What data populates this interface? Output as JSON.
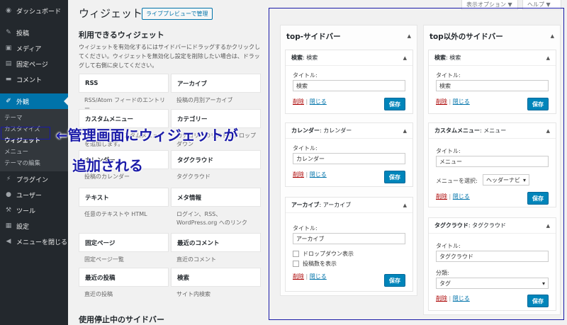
{
  "screen_meta": {
    "options": "表示オプション ▼",
    "help": "ヘルプ ▼"
  },
  "menu": {
    "dashboard": "ダッシュボード",
    "posts": "投稿",
    "media": "メディア",
    "pages": "固定ページ",
    "comments": "コメント",
    "appearance": "外観",
    "sub": {
      "themes": "テーマ",
      "customize": "カスタマイズ",
      "widgets": "ウィジェット",
      "menus": "メニュー",
      "editor": "テーマの編集"
    },
    "plugins": "プラグイン",
    "users": "ユーザー",
    "tools": "ツール",
    "settings": "設定",
    "collapse": "メニューを閉じる"
  },
  "page": {
    "title": "ウィジェット",
    "live_preview": "ライブプレビューで管理",
    "available_title": "利用できるウィジェット",
    "available_desc": "ウィジェットを有効化するにはサイドバーにドラッグするかクリックしてください。ウィジェットを無効化し設定を削除したい場合は、ドラッグして右側に戻してください。",
    "inactive_title": "使用停止中のサイドバー"
  },
  "widgets": [
    {
      "name": "RSS",
      "desc": "RSS/Atom フィードのエントリー"
    },
    {
      "name": "アーカイブ",
      "desc": "投稿の月別アーカイブ"
    },
    {
      "name": "カスタムメニュー",
      "desc": "サイドバーにカスタムメニューを追加します。"
    },
    {
      "name": "カテゴリー",
      "desc": "カテゴリーのリストやドロップダウン"
    },
    {
      "name": "カレンダー",
      "desc": "投稿のカレンダー"
    },
    {
      "name": "タグクラウド",
      "desc": "タグクラウド"
    },
    {
      "name": "テキスト",
      "desc": "任意のテキストや HTML"
    },
    {
      "name": "メタ情報",
      "desc": "ログイン、RSS、WordPress.org へのリンク"
    },
    {
      "name": "固定ページ",
      "desc": "固定ページ一覧"
    },
    {
      "name": "最近のコメント",
      "desc": "直近のコメント"
    },
    {
      "name": "最近の投稿",
      "desc": "直近の投稿"
    },
    {
      "name": "検索",
      "desc": "サイト内検索"
    }
  ],
  "annotation": {
    "line1": "←管理画面にウィジェットが",
    "line2": "追加される"
  },
  "common": {
    "title_label": "タイトル:",
    "delete": "削除",
    "close": "閉じる",
    "sep": "|",
    "save": "保存"
  },
  "sidebar_top": {
    "title": "top-サイドバー",
    "w1": {
      "head": "検索",
      "sub": ": 検索",
      "value": "検索"
    },
    "w2": {
      "head": "カレンダー",
      "sub": ": カレンダー",
      "value": "カレンダー"
    },
    "w3": {
      "head": "アーカイブ",
      "sub": ": アーカイブ",
      "value": "アーカイブ",
      "cb1": "ドロップダウン表示",
      "cb2": "投稿数を表示"
    }
  },
  "sidebar_other": {
    "title": "top以外のサイドバー",
    "w1": {
      "head": "検索",
      "sub": ": 検索",
      "value": "検索"
    },
    "w2": {
      "head": "カスタムメニュー",
      "sub": ": メニュー",
      "value": "メニュー",
      "menu_label": "メニューを選択:",
      "menu_value": "ヘッダーナビ"
    },
    "w3": {
      "head": "タグクラウド",
      "sub": ": タグクラウド",
      "value": "タグクラウド",
      "tax_label": "分類:",
      "tax_value": "タグ"
    }
  },
  "colors": {
    "admin_bg": "#23282d",
    "accent": "#0073aa",
    "button": "#0085ba",
    "annotation": "#1a1aa8"
  }
}
